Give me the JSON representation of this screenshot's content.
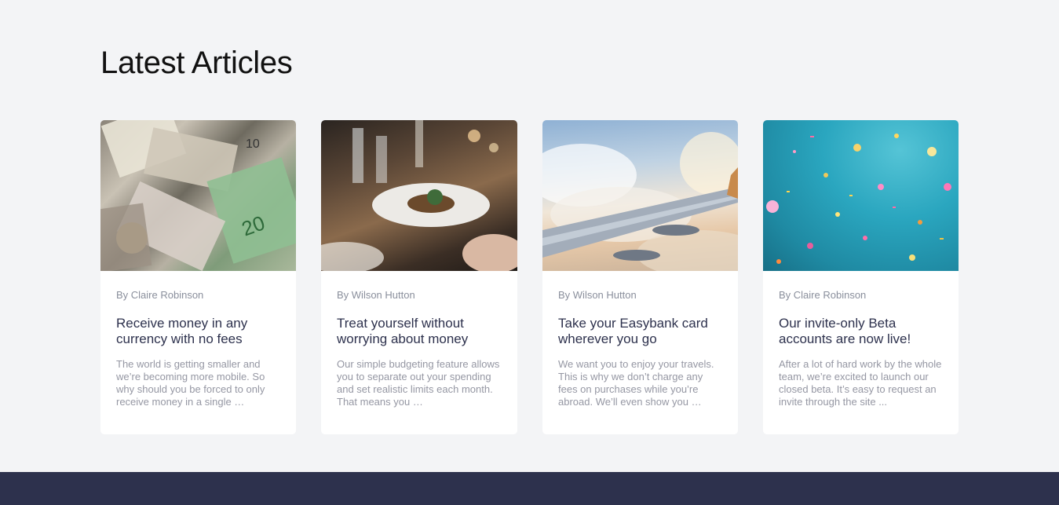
{
  "section": {
    "heading": "Latest Articles"
  },
  "articles": [
    {
      "image": "money-photo",
      "author": "By Claire Robinson",
      "title": "Receive money in any currency with no fees",
      "excerpt": "The world is getting smaller and we’re becoming more mobile. So why should you be forced to only receive money in a single …"
    },
    {
      "image": "dinner-photo",
      "author": "By Wilson Hutton",
      "title": "Treat yourself without worrying about money",
      "excerpt": "Our simple budgeting feature allows you to separate out your spending and set realistic limits each month. That means you …"
    },
    {
      "image": "airplane-wing-photo",
      "author": "By Wilson Hutton",
      "title": "Take your Easybank card wherever you go",
      "excerpt": "We want you to enjoy your travels. This is why we don’t charge any fees on purchases while you’re abroad. We’ll even show you …"
    },
    {
      "image": "confetti-photo",
      "author": "By Claire Robinson",
      "title": "Our invite-only Beta accounts are now live!",
      "excerpt": "After a lot of hard work by the whole team, we’re excited to launch our closed beta. It’s easy to request an invite through the site ..."
    }
  ],
  "colors": {
    "background": "#f3f4f6",
    "card": "#ffffff",
    "title": "#2d314d",
    "muted": "#9597a3",
    "footer": "#2d314d"
  }
}
